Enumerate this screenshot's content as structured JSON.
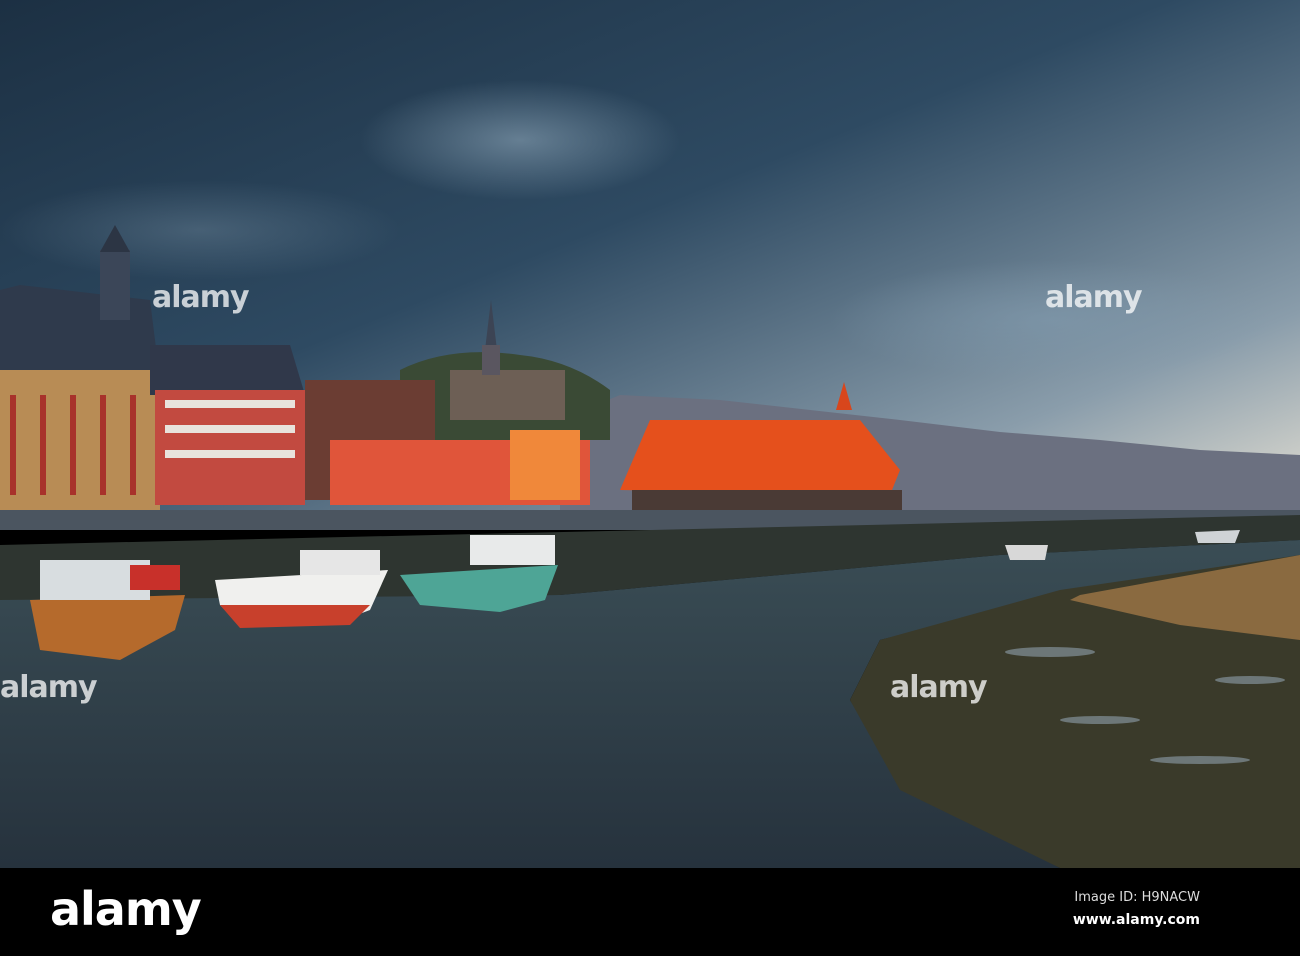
{
  "photo": {
    "subject": "harbour town",
    "colors": {
      "sky_dark": "#1f3347",
      "sky_light": "#c9d3d8",
      "roof": "#e5501c",
      "water": "#2c3a45",
      "mud": "#3b3a2a"
    }
  },
  "watermark": {
    "text": "alamy"
  },
  "footer": {
    "logo": "alamy",
    "image_id": "Image ID: H9NACW",
    "url": "www.alamy.com"
  }
}
